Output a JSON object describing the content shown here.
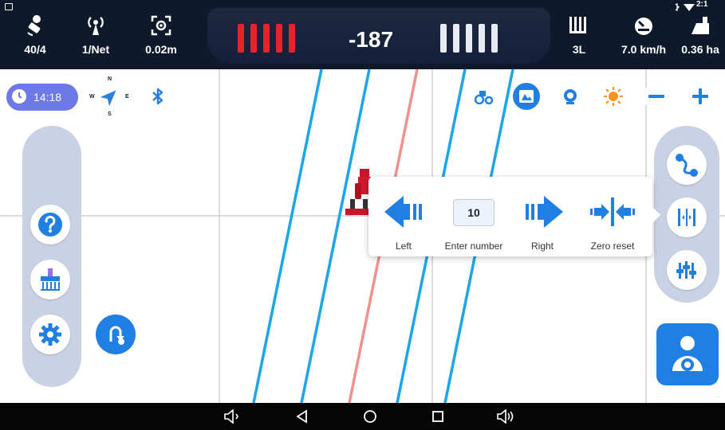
{
  "status": {
    "satellites": "40/4",
    "network": "1/Net",
    "accuracy": "0.02m",
    "deviation": "-187",
    "section": "3L",
    "speed": "7.0 km/h",
    "area": "0.36 ha",
    "clock_partial": "2:1"
  },
  "left_panel": {
    "time": "14:18",
    "compass_labels": {
      "n": "N",
      "e": "E",
      "s": "S",
      "w": "W"
    }
  },
  "popup": {
    "left_label": "Left",
    "number_label": "Enter number",
    "number_value": "10",
    "right_label": "Right",
    "reset_label": "Zero reset"
  },
  "icons": {
    "top_tools": [
      "tractor-icon",
      "map-view-icon",
      "camera-icon",
      "brightness-icon",
      "zoom-out-icon",
      "zoom-in-icon"
    ],
    "left_buttons": [
      "help-icon",
      "implement-icon",
      "settings-icon",
      "u-turn-icon"
    ],
    "right_buttons": [
      "ab-line-icon",
      "shift-line-icon",
      "adjust-icon"
    ],
    "navbar": [
      "volume-down-icon",
      "back-icon",
      "home-icon",
      "recents-icon",
      "volume-up-icon"
    ]
  },
  "colors": {
    "topbar": "#0e1a2b",
    "guidance_line": "#1aa6e8",
    "track_line": "#f0918d",
    "accent_blue": "#1f7fe3",
    "time_pill": "#6e79e8",
    "alert_red": "#e8222a"
  }
}
